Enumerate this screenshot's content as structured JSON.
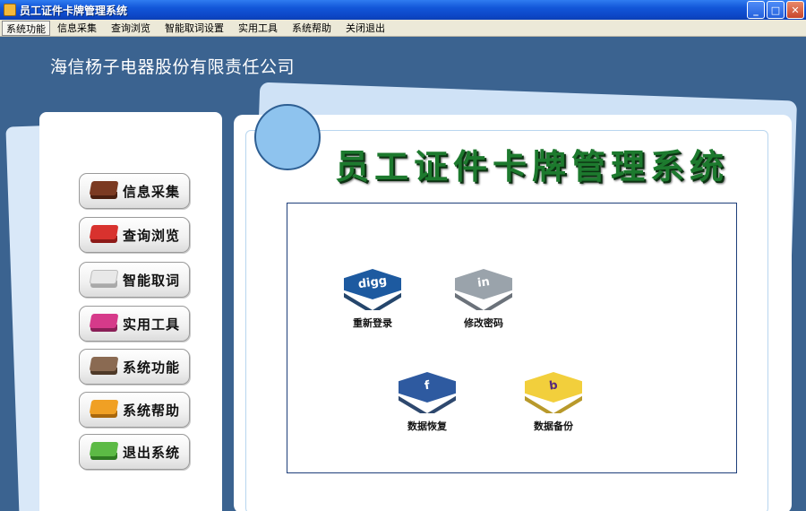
{
  "window": {
    "title": "员工证件卡牌管理系统",
    "minimize": "_",
    "maximize": "□",
    "close": "✕"
  },
  "menu": [
    {
      "label": "系统功能"
    },
    {
      "label": "信息采集"
    },
    {
      "label": "查询浏览"
    },
    {
      "label": "智能取词设置"
    },
    {
      "label": "实用工具"
    },
    {
      "label": "系统帮助"
    },
    {
      "label": "关闭退出"
    }
  ],
  "company": "海信杨子电器股份有限责任公司",
  "system_title": "员工证件卡牌管理系统",
  "sidebar": [
    {
      "label": "信息采集",
      "color": "#7b3a22",
      "side": "#4a1f10"
    },
    {
      "label": "查询浏览",
      "color": "#d8322e",
      "side": "#8d1a18"
    },
    {
      "label": "智能取词",
      "color": "#e8e8e8",
      "side": "#a9a9a9"
    },
    {
      "label": "实用工具",
      "color": "#d63a8a",
      "side": "#8a1f57"
    },
    {
      "label": "系统功能",
      "color": "#8a6a52",
      "side": "#4e3928"
    },
    {
      "label": "系统帮助",
      "color": "#f0a024",
      "side": "#a8670c"
    },
    {
      "label": "退出系统",
      "color": "#5cba45",
      "side": "#2f7a22"
    }
  ],
  "actions": [
    {
      "label": "重新登录",
      "icon": "digg-icon",
      "glyph": "digg",
      "color": "#1d5aa0",
      "shade": "#0d325c"
    },
    {
      "label": "修改密码",
      "icon": "linkedin-icon",
      "glyph": "in",
      "color": "#9aa3ab",
      "shade": "#5b636b"
    },
    {
      "label": "数据恢复",
      "icon": "facebook-icon",
      "glyph": "f",
      "color": "#2e5aa0",
      "shade": "#17345e"
    },
    {
      "label": "数据备份",
      "icon": "b-icon",
      "glyph": "b",
      "color": "#f2cf3c",
      "shade": "#b08e14"
    }
  ]
}
